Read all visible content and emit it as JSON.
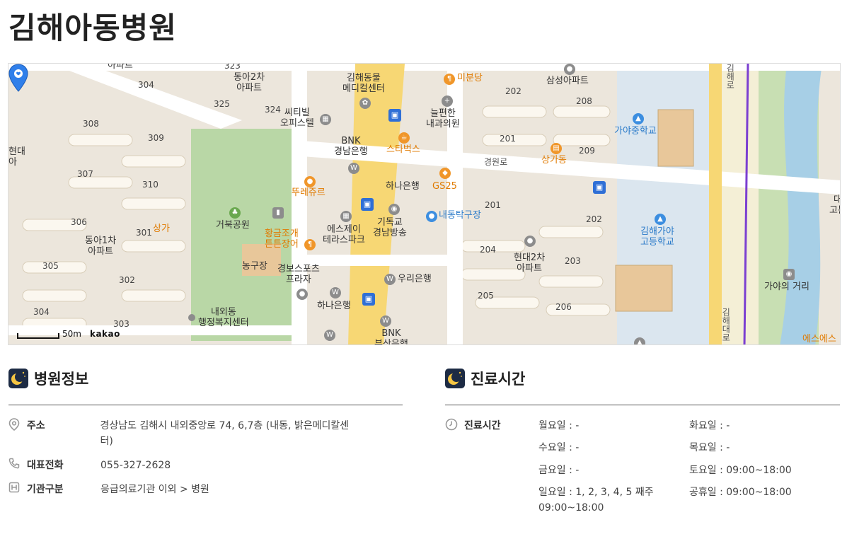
{
  "page": {
    "title": "김해아동병원"
  },
  "map": {
    "labels": {
      "l_323": "323",
      "l_304a": "304",
      "l_325": "325",
      "l_324": "324",
      "dongah2": "동아2차\n아파트",
      "apart_top": "아파트",
      "l_308": "308",
      "l_309": "309",
      "l_307": "307",
      "l_310": "310",
      "l_306": "306",
      "l_301": "301",
      "l_305": "305",
      "l_302": "302",
      "l_304b": "304",
      "l_303": "303",
      "hyundai_left": "현대\n아",
      "dongah1": "동아1차\n아파트",
      "sangga_left": "상가",
      "geobuk_park": "거북공원",
      "nonggujang": "농구장",
      "naeoe_center": "내외동\n행정복지센터",
      "gyeongbo_sports": "경보스포츠\n프라자",
      "hana_bank_bottom": "하나은행",
      "bnk_busan": "BNK\n부산은행",
      "gimhae_medical": "김해동물\n메디컬센터",
      "citybil": "씨티빌\n오피스텔",
      "bnk_gyeongnam": "BNK\n경남은행",
      "starbucks": "스타벅스",
      "tourejure": "뚜레쥬르",
      "golden_clam": "황금조개\n튼튼장어",
      "sj_terrace": "에스제이\n테라스파크",
      "christian_broadcast": "기독교\n경남방송",
      "hana_bank_top": "하나은행",
      "woori_bank": "우리은행",
      "gs25": "GS25",
      "naedong_table": "내동탁구장",
      "mibundang": "미분당",
      "neulpyeon": "늘편한\n내과의원",
      "l_202a": "202",
      "l_208": "208",
      "l_201a": "201",
      "l_209": "209",
      "samsung_apt": "삼성아파트",
      "sangga_right": "상가동",
      "gaya_middle": "가야중학교",
      "gyeongwonro": "경원로",
      "l_201b": "201",
      "l_202b": "202",
      "l_204": "204",
      "l_203": "203",
      "l_205": "205",
      "l_206": "206",
      "hyundai2": "현대2차\n아파트",
      "gimhae_gaya_high": "김해가야\n고등학교",
      "gaya_street": "가야의 거리",
      "gimhaedaero": "김해대로",
      "gimhaero_top": "김해로",
      "right_edge": "대\n고분",
      "es_es": "에스에스"
    },
    "scale": {
      "distance": "50m",
      "provider": "kakao"
    }
  },
  "hospital_info": {
    "heading": "병원정보",
    "rows": [
      {
        "label": "주소",
        "value": "경상남도 김해시 내외중앙로 74, 6,7층 (내동, 밝은메디칼센\n터)"
      },
      {
        "label": "대표전화",
        "value": "055-327-2628"
      },
      {
        "label": "기관구분",
        "value": "응급의료기관 이외 > 병원"
      }
    ]
  },
  "hours": {
    "heading": "진료시간",
    "label": "진료시간",
    "entries": [
      {
        "day": "월요일 :  -"
      },
      {
        "day": "화요일 :  -"
      },
      {
        "day": "수요일 :  -"
      },
      {
        "day": "목요일 :  -"
      },
      {
        "day": "금요일 :  -"
      },
      {
        "day": "토요일 :  09:00~18:00"
      },
      {
        "day": "일요일 :   1, 2, 3, 4, 5 째주\n09:00~18:00"
      },
      {
        "day": "공휴일 :  09:00~18:00"
      }
    ]
  },
  "colors": {
    "accent_icon": "#1d2b44",
    "moon": "#f5c542",
    "road_yellow": "#f7d774",
    "park_green": "#b9d7a6"
  },
  "icons": {
    "location": "location-pin-icon",
    "phone": "phone-icon",
    "hospital": "hospital-icon",
    "clock": "clock-icon",
    "moon": "moon-icon"
  }
}
